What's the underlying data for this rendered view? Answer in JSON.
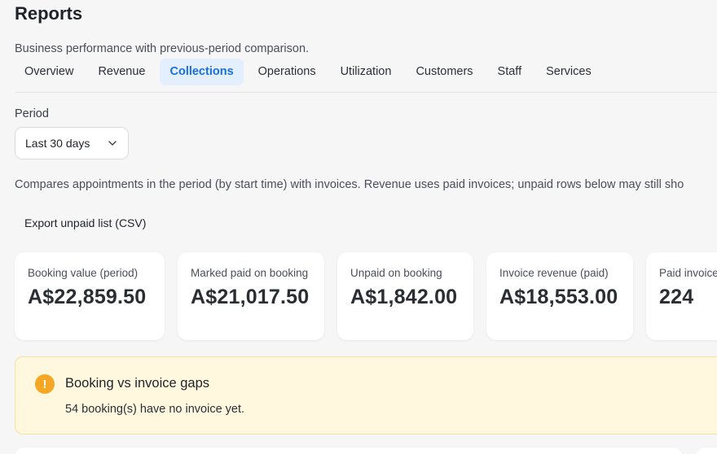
{
  "header": {
    "title": "Reports",
    "subtitle": "Business performance with previous-period comparison."
  },
  "tabs": [
    {
      "label": "Overview"
    },
    {
      "label": "Revenue"
    },
    {
      "label": "Collections",
      "active": true
    },
    {
      "label": "Operations"
    },
    {
      "label": "Utilization"
    },
    {
      "label": "Customers"
    },
    {
      "label": "Staff"
    },
    {
      "label": "Services"
    }
  ],
  "period": {
    "label": "Period",
    "selected": "Last 30 days"
  },
  "description": "Compares appointments in the period (by start time) with invoices. Revenue uses paid invoices; unpaid rows below may still sho",
  "export_label": "Export unpaid list (CSV)",
  "cards": [
    {
      "label": "Booking value (period)",
      "value": "A$22,859.50"
    },
    {
      "label": "Marked paid on booking",
      "value": "A$21,017.50"
    },
    {
      "label": "Unpaid on booking",
      "value": "A$1,842.00"
    },
    {
      "label": "Invoice revenue (paid)",
      "value": "A$18,553.00"
    },
    {
      "label": "Paid invoices",
      "value": "224"
    }
  ],
  "alert": {
    "icon": "warning-icon",
    "title": "Booking vs invoice gaps",
    "message": "54 booking(s) have no invoice yet."
  },
  "colors": {
    "accent": "#1a6fd8",
    "accent_bg": "#e3effd",
    "warning": "#f5a623",
    "warning_bg": "#fff8df"
  }
}
